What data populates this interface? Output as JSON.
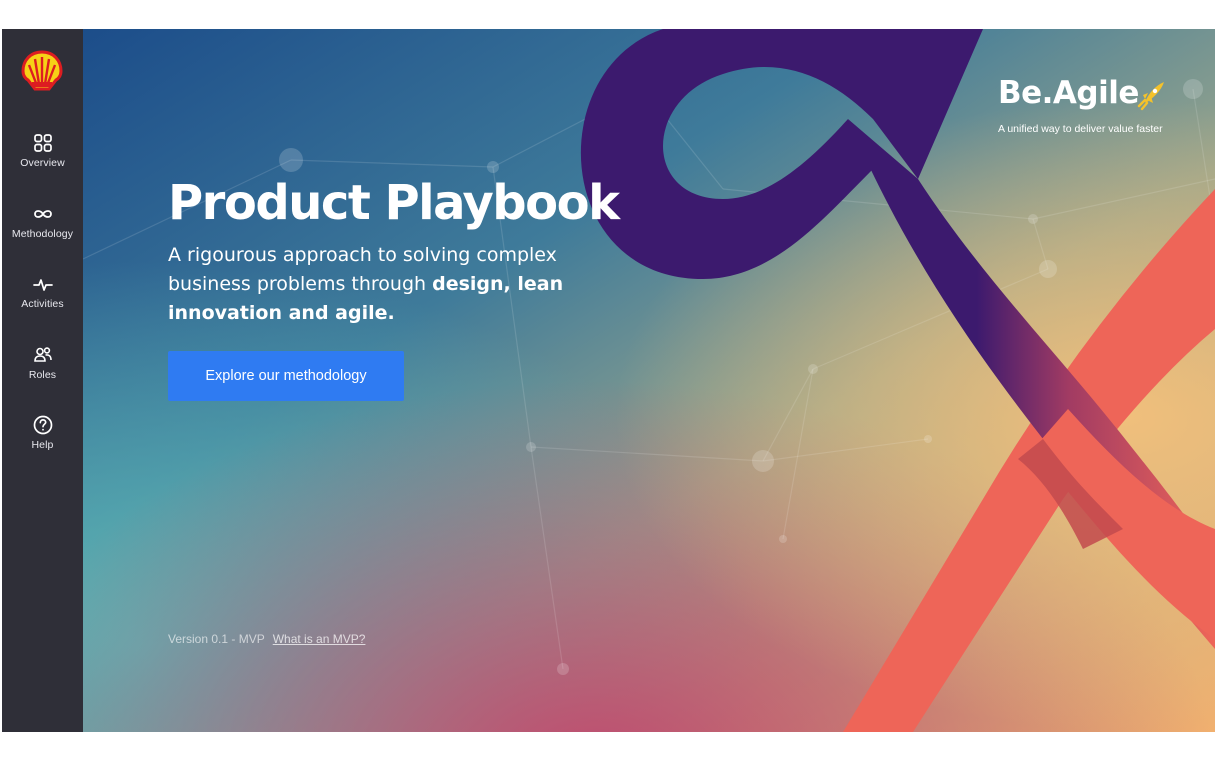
{
  "sidebar": {
    "logo_icon": "shell-pecten-icon",
    "items": [
      {
        "label": "Overview",
        "icon": "grid-icon"
      },
      {
        "label": "Methodology",
        "icon": "infinity-icon"
      },
      {
        "label": "Activities",
        "icon": "pulse-icon"
      },
      {
        "label": "Roles",
        "icon": "people-icon"
      },
      {
        "label": "Help",
        "icon": "help-circle-icon"
      }
    ]
  },
  "hero": {
    "title": "Product Playbook",
    "subtitle_start": "A rigourous approach to solving complex business problems through ",
    "subtitle_bold": "design, lean innovation and agile.",
    "cta_label": "Explore our methodology",
    "version_text": "Version 0.1 - MVP",
    "version_link": "What is an MVP?"
  },
  "brand": {
    "name": "Be.Agile",
    "tagline": "A unified way to deliver value faster",
    "icon": "rocket-icon"
  },
  "colors": {
    "sidebar_bg": "#2f2f38",
    "cta_bg": "#2f7bf2",
    "ribbon_purple": "#3c1a6e",
    "ribbon_coral": "#ee6558"
  }
}
